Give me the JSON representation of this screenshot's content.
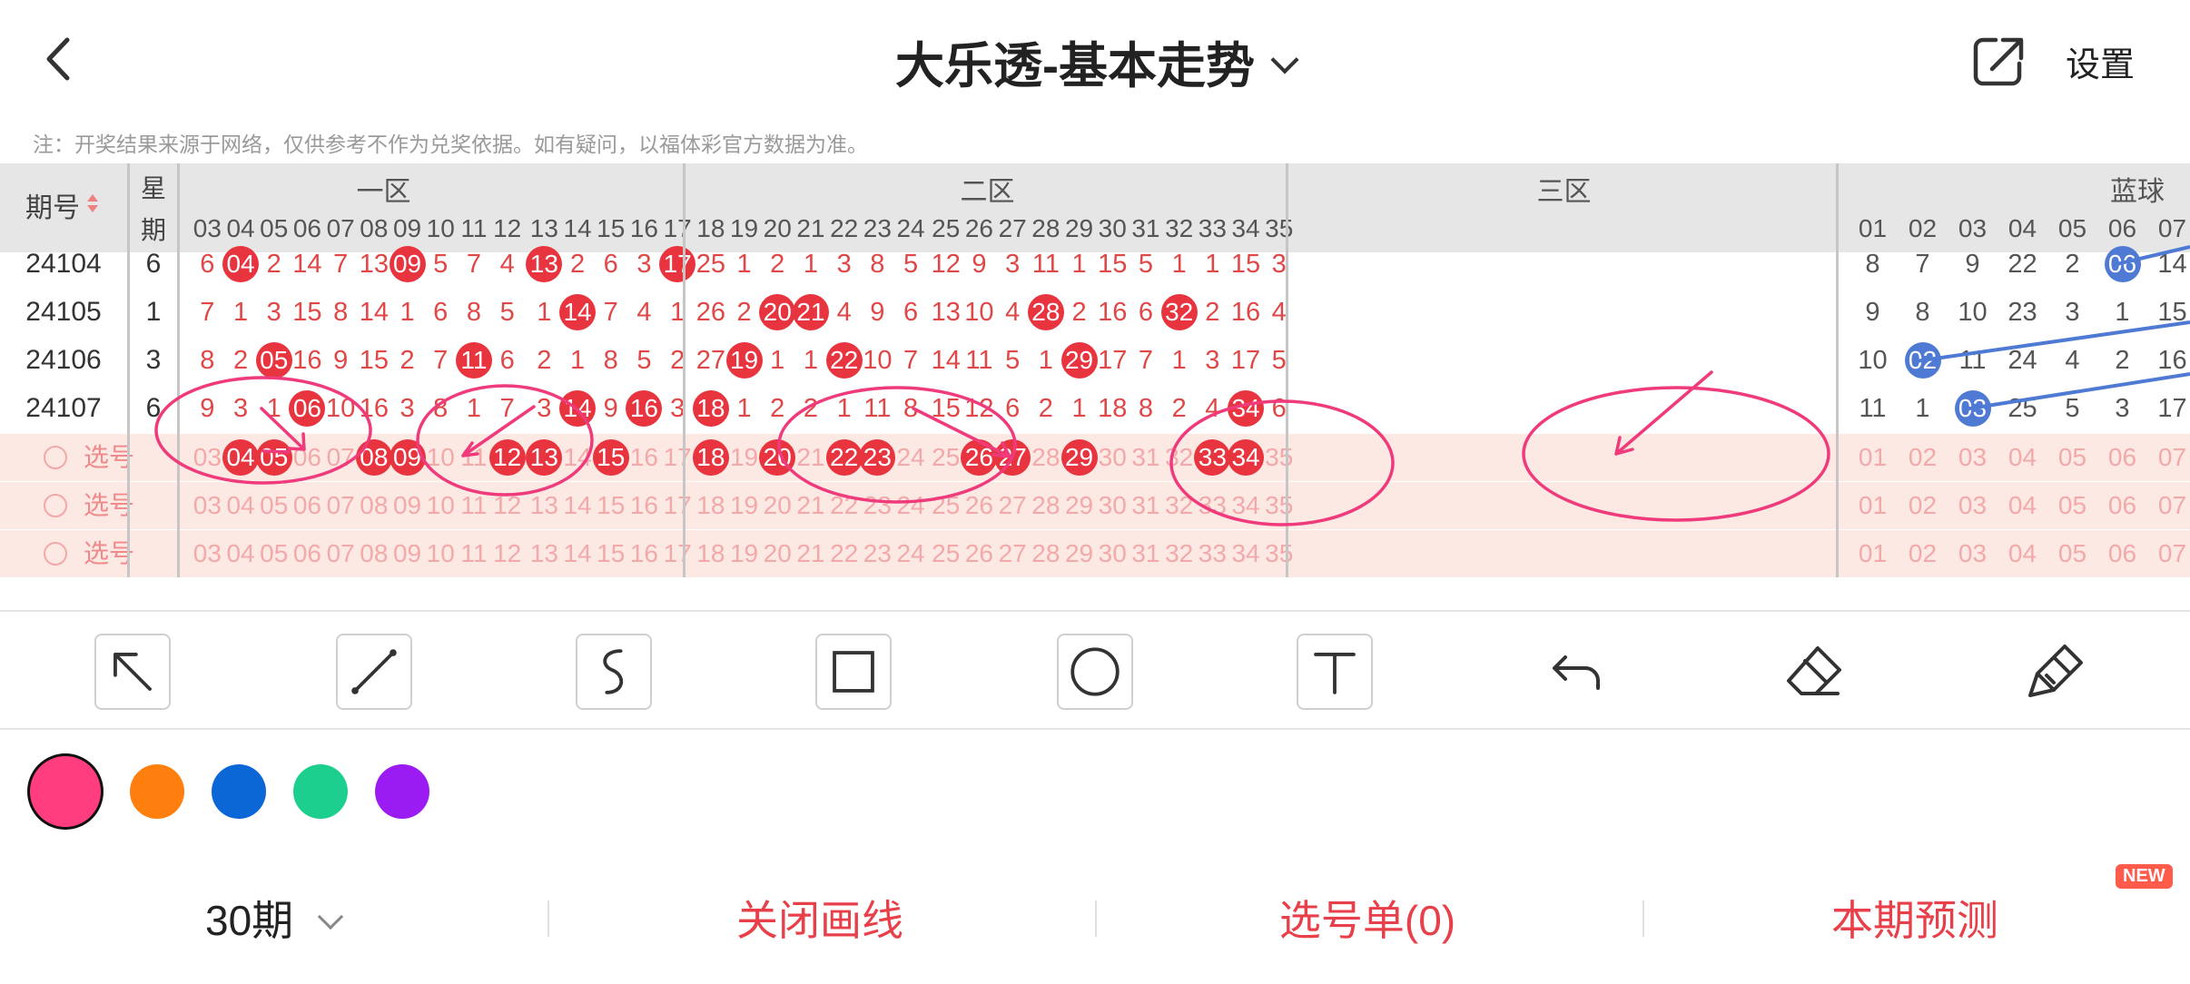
{
  "header": {
    "title": "大乐透-基本走势",
    "settings_label": "设置"
  },
  "note": "注：开奖结果来源于网络，仅供参考不作为兑奖依据。如有疑问，以福体彩官方数据为准。",
  "table": {
    "period_header": "期号",
    "week_header_1": "星",
    "week_header_2": "期",
    "zones": [
      "一区",
      "二区",
      "三区",
      "蓝球"
    ],
    "front_numbers": [
      "03",
      "04",
      "05",
      "06",
      "07",
      "08",
      "09",
      "10",
      "11",
      "12",
      "13",
      "14",
      "15",
      "16",
      "17",
      "18",
      "19",
      "20",
      "21",
      "22",
      "23",
      "24",
      "25",
      "26",
      "27",
      "28",
      "29",
      "30",
      "31",
      "32",
      "33",
      "34",
      "35"
    ],
    "blue_numbers": [
      "01",
      "02",
      "03",
      "04",
      "05",
      "06",
      "07"
    ],
    "rows": [
      {
        "period": "24104",
        "week": "6",
        "front": [
          "6",
          "04",
          "2",
          "14",
          "7",
          "13",
          "09",
          "5",
          "7",
          "4",
          "13",
          "2",
          "6",
          "3",
          "17",
          "25",
          "1",
          "2",
          "1",
          "3",
          "8",
          "5",
          "12",
          "9",
          "3",
          "11",
          "1",
          "15",
          "5",
          "1",
          "1",
          "15",
          "3"
        ],
        "front_hit": [
          false,
          true,
          false,
          false,
          false,
          false,
          true,
          false,
          false,
          false,
          true,
          false,
          false,
          false,
          true,
          false,
          false,
          false,
          false,
          false,
          false,
          false,
          false,
          false,
          false,
          false,
          false,
          false,
          false,
          false,
          false,
          false,
          false
        ],
        "blue": [
          "8",
          "7",
          "9",
          "22",
          "2",
          "06",
          "14"
        ],
        "blue_hit": [
          false,
          false,
          false,
          false,
          false,
          true,
          false
        ]
      },
      {
        "period": "24105",
        "week": "1",
        "front": [
          "7",
          "1",
          "3",
          "15",
          "8",
          "14",
          "1",
          "6",
          "8",
          "5",
          "1",
          "14",
          "7",
          "4",
          "1",
          "26",
          "2",
          "20",
          "21",
          "4",
          "9",
          "6",
          "13",
          "10",
          "4",
          "28",
          "2",
          "16",
          "6",
          "32",
          "2",
          "16",
          "4"
        ],
        "front_hit": [
          false,
          false,
          false,
          false,
          false,
          false,
          false,
          false,
          false,
          false,
          false,
          true,
          false,
          false,
          false,
          false,
          false,
          true,
          true,
          false,
          false,
          false,
          false,
          false,
          false,
          true,
          false,
          false,
          false,
          true,
          false,
          false,
          false
        ],
        "blue": [
          "9",
          "8",
          "10",
          "23",
          "3",
          "1",
          "15"
        ],
        "blue_hit": [
          false,
          false,
          false,
          false,
          false,
          false,
          false
        ]
      },
      {
        "period": "24106",
        "week": "3",
        "front": [
          "8",
          "2",
          "05",
          "16",
          "9",
          "15",
          "2",
          "7",
          "11",
          "6",
          "2",
          "1",
          "8",
          "5",
          "2",
          "27",
          "19",
          "1",
          "1",
          "22",
          "10",
          "7",
          "14",
          "11",
          "5",
          "1",
          "29",
          "17",
          "7",
          "1",
          "3",
          "17",
          "5"
        ],
        "front_hit": [
          false,
          false,
          true,
          false,
          false,
          false,
          false,
          false,
          true,
          false,
          false,
          false,
          false,
          false,
          false,
          false,
          true,
          false,
          false,
          true,
          false,
          false,
          false,
          false,
          false,
          false,
          true,
          false,
          false,
          false,
          false,
          false,
          false
        ],
        "blue": [
          "10",
          "02",
          "11",
          "24",
          "4",
          "2",
          "16"
        ],
        "blue_hit": [
          false,
          true,
          false,
          false,
          false,
          false,
          false
        ]
      },
      {
        "period": "24107",
        "week": "6",
        "front": [
          "9",
          "3",
          "1",
          "06",
          "10",
          "16",
          "3",
          "8",
          "1",
          "7",
          "3",
          "14",
          "9",
          "16",
          "3",
          "18",
          "1",
          "2",
          "2",
          "1",
          "11",
          "8",
          "15",
          "12",
          "6",
          "2",
          "1",
          "18",
          "8",
          "2",
          "4",
          "34",
          "6"
        ],
        "front_hit": [
          false,
          false,
          false,
          true,
          false,
          false,
          false,
          false,
          false,
          false,
          false,
          true,
          false,
          true,
          false,
          true,
          false,
          false,
          false,
          false,
          false,
          false,
          false,
          false,
          false,
          false,
          false,
          false,
          false,
          false,
          false,
          true,
          false
        ],
        "blue": [
          "11",
          "1",
          "03",
          "25",
          "5",
          "3",
          "17"
        ],
        "blue_hit": [
          false,
          false,
          true,
          false,
          false,
          false,
          false
        ]
      }
    ],
    "select_label": "选号",
    "select_highlighted": [
      "04",
      "05",
      "08",
      "09",
      "12",
      "13",
      "15",
      "18",
      "20",
      "22",
      "23",
      "26",
      "27",
      "29",
      "33",
      "34"
    ]
  },
  "tools": [
    "arrow-tool",
    "line-tool",
    "curve-tool",
    "rect-tool",
    "circle-tool",
    "text-tool",
    "undo-tool",
    "eraser-tool",
    "clear-tool"
  ],
  "colors": [
    "#ff3d7f",
    "#ff7f0e",
    "#0b66d6",
    "#1ccf8e",
    "#9b1cf2"
  ],
  "bottom": {
    "period_label": "30期",
    "close_label": "关闭画线",
    "cart_label": "选号单(0)",
    "predict_label": "本期预测",
    "new_badge": "NEW"
  }
}
